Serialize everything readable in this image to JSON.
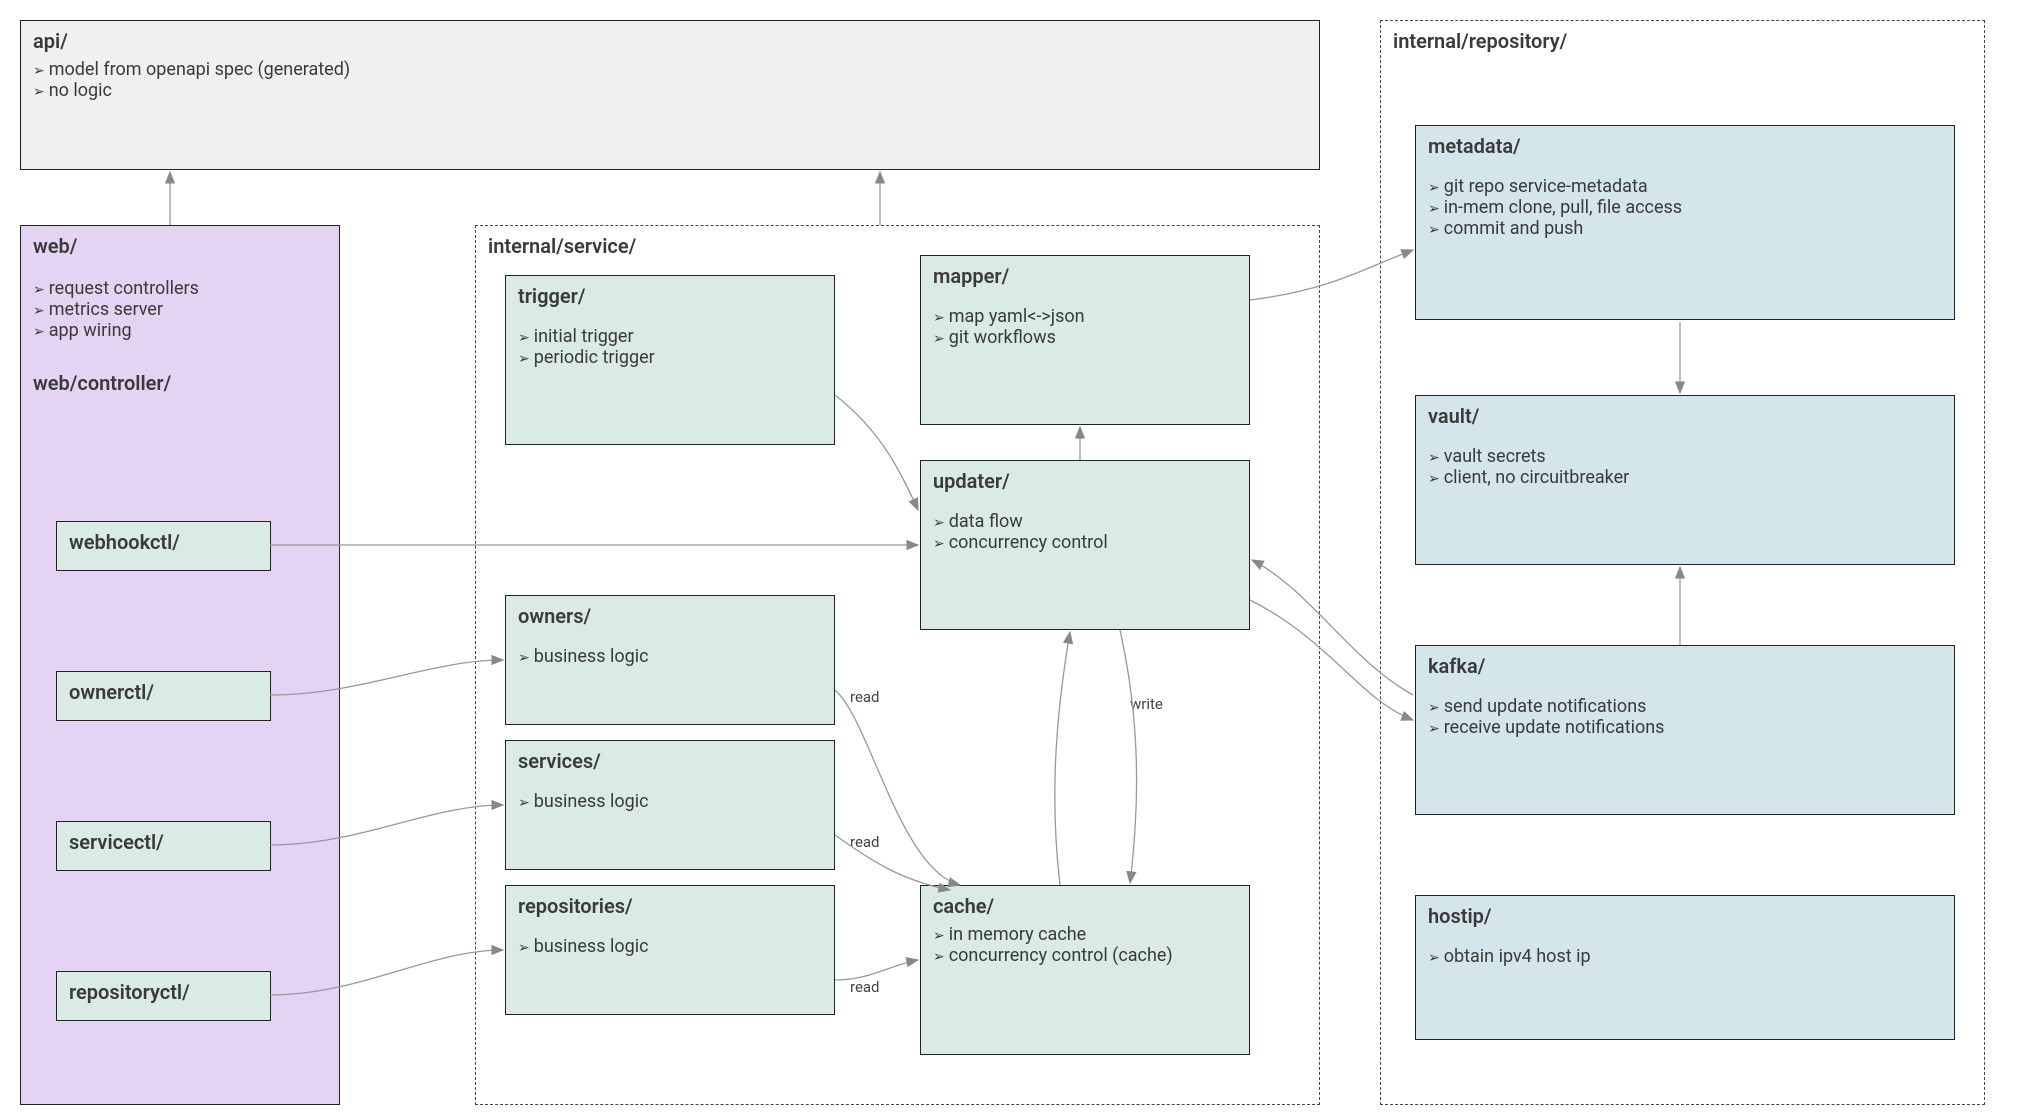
{
  "api": {
    "title": "api/",
    "items": [
      "model from openapi spec (generated)",
      "no logic"
    ]
  },
  "web": {
    "title": "web/",
    "items": [
      "request controllers",
      "metrics server",
      "app wiring"
    ],
    "controller_title": "web/controller/",
    "controllers": {
      "webhookctl": "webhookctl/",
      "ownerctl": "ownerctl/",
      "servicectl": "servicectl/",
      "repositoryctl": "repositoryctl/"
    }
  },
  "service": {
    "title": "internal/service/",
    "trigger": {
      "title": "trigger/",
      "items": [
        "initial trigger",
        "periodic trigger"
      ]
    },
    "mapper": {
      "title": "mapper/",
      "items": [
        "map yaml<->json",
        "git workflows"
      ]
    },
    "updater": {
      "title": "updater/",
      "items": [
        "data flow",
        "concurrency control"
      ]
    },
    "owners": {
      "title": "owners/",
      "items": [
        "business logic"
      ]
    },
    "services": {
      "title": "services/",
      "items": [
        "business logic"
      ]
    },
    "repositories": {
      "title": "repositories/",
      "items": [
        "business logic"
      ]
    },
    "cache": {
      "title": "cache/",
      "items": [
        "in memory cache",
        "concurrency control (cache)"
      ]
    }
  },
  "repository": {
    "title": "internal/repository/",
    "metadata": {
      "title": "metadata/",
      "items": [
        "git repo service-metadata",
        "in-mem clone, pull, file access",
        "commit and push"
      ]
    },
    "vault": {
      "title": "vault/",
      "items": [
        "vault secrets",
        "client, no circuitbreaker"
      ]
    },
    "kafka": {
      "title": "kafka/",
      "items": [
        "send update notifications",
        "receive update notifications"
      ]
    },
    "hostip": {
      "title": "hostip/",
      "items": [
        "obtain ipv4 host ip"
      ]
    }
  },
  "labels": {
    "read1": "read",
    "read2": "read",
    "read3": "read",
    "write": "write"
  }
}
